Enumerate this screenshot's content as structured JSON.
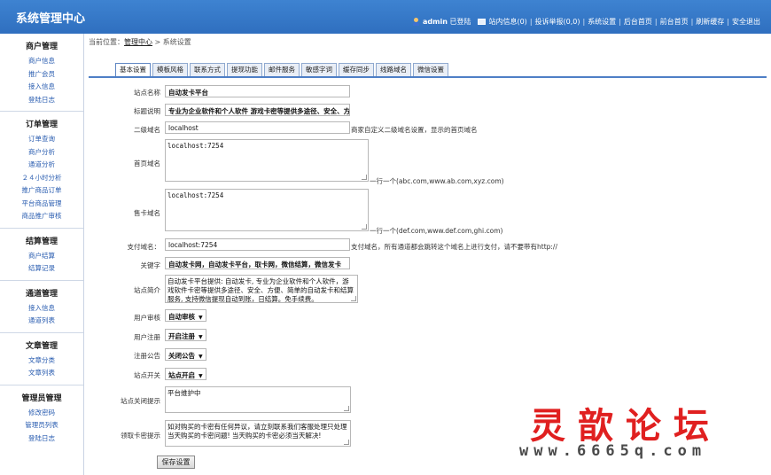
{
  "header": {
    "title": "系统管理中心",
    "user": "admin",
    "logged_in": "已登陆",
    "messages": "站内信息(0)",
    "complaints": "投诉举报(0,0)",
    "system_settings": "系统设置",
    "backend_home": "后台首页",
    "frontend_home": "前台首页",
    "refresh_cache": "刷新缓存",
    "logout": "安全退出",
    "sep": "|"
  },
  "sidebar": {
    "groups": [
      {
        "title": "商户管理",
        "items": [
          "商户信息",
          "推广会员",
          "接入信息",
          "登陆日志"
        ]
      },
      {
        "title": "订单管理",
        "items": [
          "订单查询",
          "商户分析",
          "通道分析",
          "２４小时分析",
          "推广商品订单",
          "平台商品管理",
          "商品推广审核"
        ]
      },
      {
        "title": "结算管理",
        "items": [
          "商户结算",
          "结算记录"
        ]
      },
      {
        "title": "通道管理",
        "items": [
          "接入信息",
          "通道列表"
        ]
      },
      {
        "title": "文章管理",
        "items": [
          "文章分类",
          "文章列表"
        ]
      },
      {
        "title": "管理员管理",
        "items": [
          "修改密码",
          "管理员列表",
          "登陆日志"
        ]
      }
    ]
  },
  "breadcrumb": {
    "prefix": "当前位置：",
    "home": "管理中心",
    "sep": " > ",
    "current": "系统设置"
  },
  "tabs": [
    "基本设置",
    "模板风格",
    "联系方式",
    "提现功能",
    "邮件服务",
    "敏感字词",
    "缓存同步",
    "线路域名",
    "微信设置"
  ],
  "form": {
    "site_name": {
      "label": "站点名称",
      "value": "自动发卡平台"
    },
    "title_desc": {
      "label": "标题说明",
      "value": "专业为企业软件和个人软件 游戏卡密等提供多途径、安全、方"
    },
    "subdomain": {
      "label": "二级域名",
      "value": "localhost",
      "hint": "商家自定义二级域名设置，显示的首页域名"
    },
    "home_domain": {
      "label": "首页域名",
      "value": "localhost:7254",
      "hint": "一行一个(abc.com,www.ab.com,xyz.com)"
    },
    "card_domain": {
      "label": "售卡域名",
      "value": "localhost:7254",
      "hint": "一行一个(def.com,www.def.com,ghi.com)"
    },
    "pay_domain": {
      "label": "支付域名：",
      "value": "localhost:7254",
      "hint": "支付域名，所有通道都会跳转这个域名上进行支付，请不要带有http://"
    },
    "keywords": {
      "label": "关键字",
      "value": "自动发卡网，自动发卡平台，取卡网，微信结算，微信发卡"
    },
    "site_intro": {
      "label": "站点简介",
      "value": "自动发卡平台提供: 自动发卡, 专业为企业软件和个人软件，游戏软件卡密等提供多途径、安全、方便、简单的自动发卡和结算服务, 支持微信提现自动到账，日结算。免手续费。"
    },
    "user_review": {
      "label": "用户审核",
      "value": "自动审核"
    },
    "user_register": {
      "label": "用户注册",
      "value": "开启注册"
    },
    "register_notice": {
      "label": "注册公告",
      "value": "关闭公告"
    },
    "site_switch": {
      "label": "站点开关",
      "value": "站点开启"
    },
    "site_close_tip": {
      "label": "站点关闭提示",
      "value": "平台维护中"
    },
    "card_pickup_tip": {
      "label": "领取卡密提示",
      "value": "如对购买的卡密有任何异议，请立刻联系我们客服处理只处理当天购买的卡密问题! 当天购买的卡密必须当天解决!"
    },
    "save_label": "保存设置"
  },
  "watermark": {
    "title": "灵歆论坛",
    "url": "www.6665q.com"
  }
}
